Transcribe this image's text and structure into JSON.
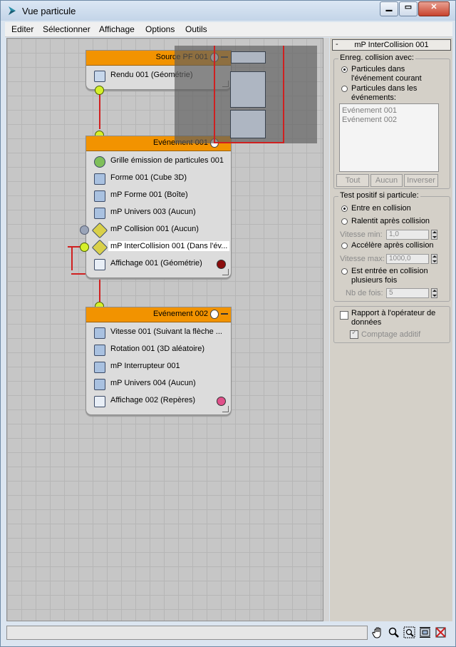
{
  "window": {
    "title": "Vue particule"
  },
  "menu": [
    "Editer",
    "Sélectionner",
    "Affichage",
    "Options",
    "Outils"
  ],
  "nodes": {
    "source": {
      "title": "Source PF 001",
      "ops": [
        {
          "label": "Rendu 001 (Géométrie)",
          "icon": "teapot-icon"
        }
      ]
    },
    "event1": {
      "title": "Evénement 001",
      "ops": [
        {
          "label": "Grille émission de particules 001",
          "icon": "grid-birth-icon"
        },
        {
          "label": "Forme 001 (Cube 3D)",
          "icon": "shape-icon"
        },
        {
          "label": "mP Forme 001 (Boîte)",
          "icon": "mp-shape-icon"
        },
        {
          "label": "mP Univers 003 (Aucun)",
          "icon": "mp-world-icon"
        },
        {
          "label": "mP Collision 001 (Aucun)",
          "icon": "mp-collision-icon"
        },
        {
          "label": "mP InterCollision 001 (Dans l'év...",
          "icon": "mp-intercollision-icon"
        },
        {
          "label": "Affichage 001 (Géométrie)",
          "icon": "display-icon",
          "swatch": "#8b0d0d"
        }
      ]
    },
    "event2": {
      "title": "Evénement 002",
      "ops": [
        {
          "label": "Vitesse 001 (Suivant la flèche ...",
          "icon": "speed-icon"
        },
        {
          "label": "Rotation 001 (3D aléatoire)",
          "icon": "rotation-icon"
        },
        {
          "label": "mP Interrupteur  001",
          "icon": "mp-switch-icon"
        },
        {
          "label": "mP Univers 004 (Aucun)",
          "icon": "mp-world-icon"
        },
        {
          "label": "Affichage 002 (Repères)",
          "icon": "display-icon",
          "swatch": "#e0508a"
        }
      ]
    }
  },
  "panel": {
    "rollout_title": "mP InterCollision 001",
    "rollout_toggle": "-",
    "group1": {
      "title": "Enreg. collision avec:",
      "option1": "Particules dans l'événement courant",
      "option2": "Particules dans les événements:",
      "selected": "option1",
      "list": [
        "Evénement 001",
        "Evénement 002"
      ],
      "buttons": [
        "Tout",
        "Aucun",
        "Inverser"
      ]
    },
    "group2": {
      "title": "Test positif si particule:",
      "options": [
        "Entre en collision",
        "Ralentit après collision",
        "Accélère après collision",
        "Est entrée en collision plusieurs fois"
      ],
      "selected_index": 0,
      "speed_min_label": "Vitesse min:",
      "speed_min_value": "1,0",
      "speed_max_label": "Vitesse max:",
      "speed_max_value": "1000,0",
      "times_label": "Nb de fois:",
      "times_value": "5"
    },
    "report": {
      "label": "Rapport à l'opérateur de données",
      "checked": false
    },
    "additive": {
      "label": "Comptage additif",
      "checked": true
    }
  },
  "status": {
    "text": ""
  },
  "tools": [
    "hand-pan-icon",
    "zoom-icon",
    "zoom-region-icon",
    "zoom-extents-icon",
    "no-computing-icon"
  ],
  "colors": {
    "node_header": "#f29300",
    "wire": "#d02020",
    "socket": "#d6f02a"
  }
}
